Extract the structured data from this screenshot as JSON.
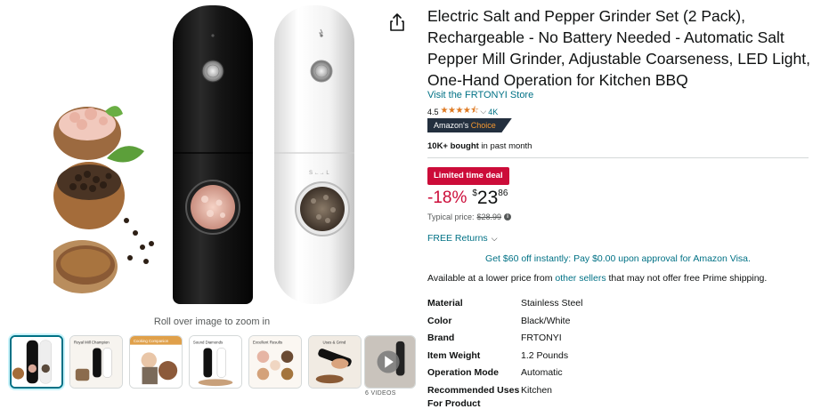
{
  "gallery": {
    "zoom_hint": "Roll over image to zoom in",
    "video_count": "6 VIDEOS",
    "thumbnails": [
      {
        "name": "main-product-thumbnail",
        "selected": true
      },
      {
        "name": "royal-mill-thumbnail",
        "selected": false
      },
      {
        "name": "cooking-thumbnail",
        "selected": false
      },
      {
        "name": "grinding-thumbnail",
        "selected": false
      },
      {
        "name": "salt-pepper-thumbnail",
        "selected": false
      },
      {
        "name": "handheld-thumbnail",
        "selected": false
      },
      {
        "name": "video-thumbnail",
        "selected": false
      }
    ],
    "thumb_labels": [
      "Royal Mill Champion",
      "Cooking Companion",
      "Sound Diamonds",
      "Excellent Results",
      "Uses & Grind"
    ]
  },
  "product": {
    "title": "Electric Salt and Pepper Grinder Set (2 Pack), Rechargeable - No Battery Needed - Automatic Salt Pepper Mill Grinder, Adjustable Coarseness, LED Light, One-Hand Operation for Kitchen BBQ",
    "store_link": "Visit the FRTONYI Store",
    "rating_value": "4.5",
    "rating_stars": "★★★★⯪",
    "rating_count": "4K",
    "choice_badge_prefix": "Amazon's",
    "choice_badge_accent": "Choice",
    "bought_bold": "10K+ bought",
    "bought_rest": " in past month",
    "deal_badge": "Limited time deal",
    "discount": "-18%",
    "currency": "$",
    "price_whole": "23",
    "price_fraction": "86",
    "typical_label": "Typical price:",
    "typical_price": "$28.99",
    "free_returns": "FREE Returns",
    "promo": "Get $60 off instantly: Pay $0.00 upon approval for Amazon Visa.",
    "lower_price_prefix": "Available at a lower price from ",
    "lower_price_link": "other sellers",
    "lower_price_suffix": " that may not offer free Prime shipping.",
    "specs": [
      {
        "key": "Material",
        "value": "Stainless Steel"
      },
      {
        "key": "Color",
        "value": "Black/White"
      },
      {
        "key": "Brand",
        "value": "FRTONYI"
      },
      {
        "key": "Item Weight",
        "value": "1.2 Pounds"
      },
      {
        "key": "Operation Mode",
        "value": "Automatic"
      },
      {
        "key": "Recommended Uses For Product",
        "value": "Kitchen"
      }
    ]
  },
  "colors": {
    "link": "#007185",
    "deal_red": "#cc0c39",
    "star_orange": "#de7921",
    "badge_dark": "#232f3e",
    "badge_accent": "#f69931"
  }
}
